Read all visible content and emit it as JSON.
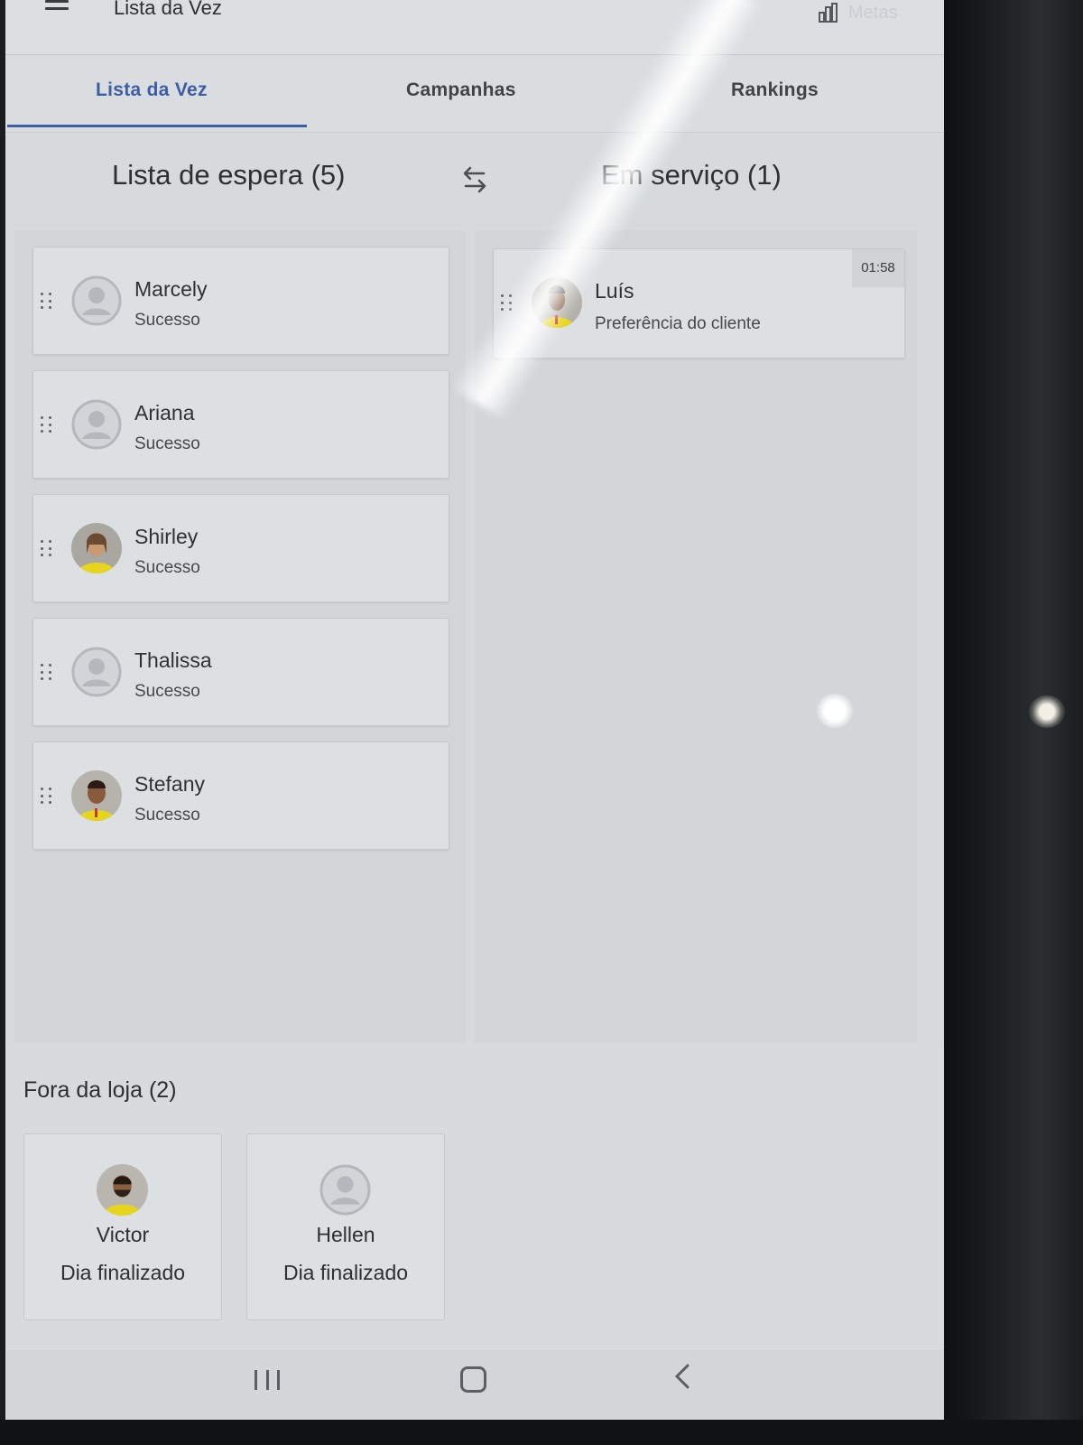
{
  "appbar": {
    "title": "Lista da Vez",
    "metas_label": "Metas"
  },
  "tabs": [
    {
      "label": "Lista da Vez"
    },
    {
      "label": "Campanhas"
    },
    {
      "label": "Rankings"
    }
  ],
  "waiting": {
    "title": "Lista de espera (5)",
    "items": [
      {
        "name": "Marcely",
        "status": "Sucesso",
        "avatar": "placeholder-avatar-icon"
      },
      {
        "name": "Ariana",
        "status": "Sucesso",
        "avatar": "placeholder-avatar-icon"
      },
      {
        "name": "Shirley",
        "status": "Sucesso",
        "avatar": "photo"
      },
      {
        "name": "Thalissa",
        "status": "Sucesso",
        "avatar": "placeholder-avatar-icon"
      },
      {
        "name": "Stefany",
        "status": "Sucesso",
        "avatar": "photo"
      }
    ]
  },
  "in_service": {
    "title": "Em serviço (1)",
    "items": [
      {
        "name": "Luís",
        "status": "Preferência do cliente",
        "timer": "01:58",
        "avatar": "photo"
      }
    ]
  },
  "outside": {
    "title": "Fora da loja (2)",
    "items": [
      {
        "name": "Victor",
        "status": "Dia finalizado",
        "avatar": "photo"
      },
      {
        "name": "Hellen",
        "status": "Dia finalizado",
        "avatar": "placeholder-avatar-icon"
      }
    ]
  },
  "colors": {
    "accent": "#3d5ea6",
    "uniform_yellow": "#e7d41c"
  }
}
